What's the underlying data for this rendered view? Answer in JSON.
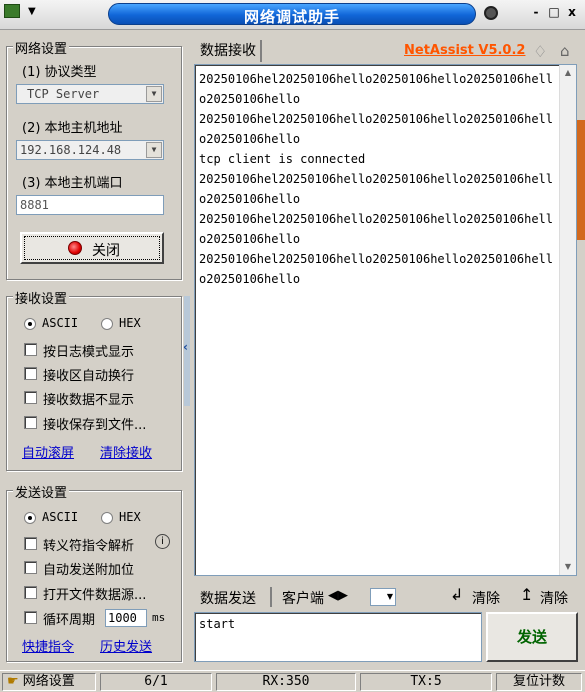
{
  "window": {
    "title": "网络调试助手",
    "controls": [
      "-",
      "□",
      "x"
    ]
  },
  "brand": "NetAssist V5.0.2",
  "network": {
    "group_title": "网络设置",
    "protocol_label": "(1) 协议类型",
    "protocol_value": "TCP Server",
    "host_label": "(2) 本地主机地址",
    "host_value": "192.168.124.48",
    "port_label": "(3) 本地主机端口",
    "port_value": "8881",
    "close_label": "关闭"
  },
  "receive_settings": {
    "group_title": "接收设置",
    "ascii": "ASCII",
    "hex": "HEX",
    "opt1": "按日志模式显示",
    "opt2": "接收区自动换行",
    "opt3": "接收数据不显示",
    "opt4": "接收保存到文件...",
    "link_autoscroll": "自动滚屏",
    "link_clear": "清除接收"
  },
  "send_settings": {
    "group_title": "发送设置",
    "ascii": "ASCII",
    "hex": "HEX",
    "opt1": "转义符指令解析",
    "opt2": "自动发送附加位",
    "opt3": "打开文件数据源...",
    "opt4": "循环周期",
    "period_value": "1000",
    "period_unit": "ms",
    "link_shortcut": "快捷指令",
    "link_history": "历史发送"
  },
  "receive": {
    "tab": "数据接收",
    "text": "20250106hel20250106hello20250106hello20250106hello20250106hello\n20250106hel20250106hello20250106hello20250106hello20250106hello\ntcp client is connected\n20250106hel20250106hello20250106hello20250106hello20250106hello\n20250106hel20250106hello20250106hello20250106hello20250106hello\n20250106hel20250106hello20250106hello20250106hello20250106hello"
  },
  "send": {
    "tab": "数据发送",
    "client_label": "客户端",
    "clear1": "清除",
    "clear2": "清除",
    "input_value": "start",
    "send_label": "发送"
  },
  "status": {
    "settings_label": "网络设置",
    "page": "6/1",
    "rx": "RX:350",
    "tx": "TX:5",
    "reset": "复位计数"
  }
}
